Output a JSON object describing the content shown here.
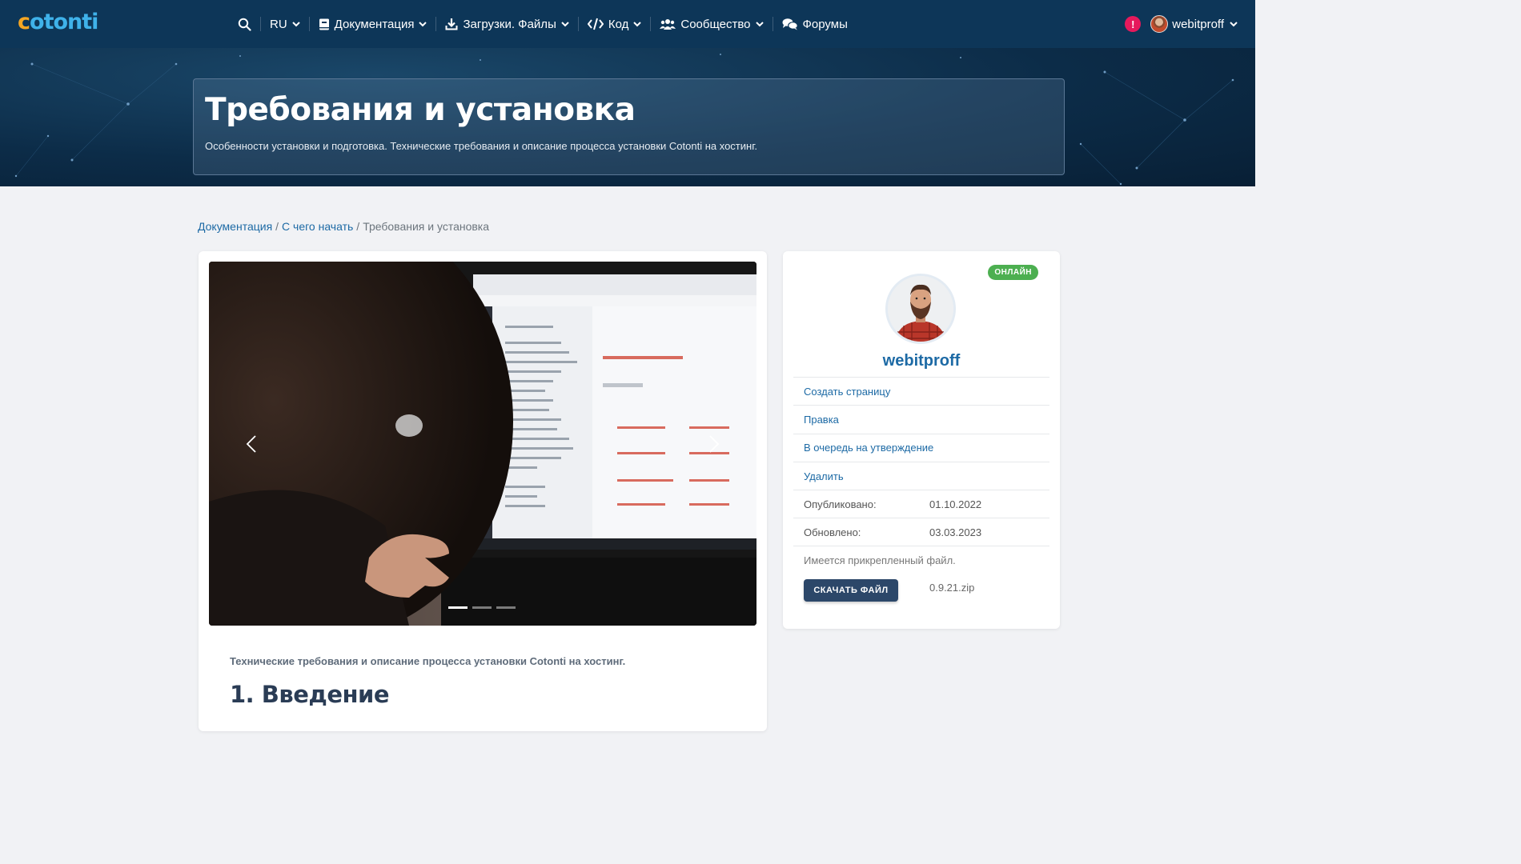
{
  "logo": {
    "first_letter": "c",
    "rest": "otonti"
  },
  "nav": {
    "search_icon": "search-icon",
    "lang": "RU",
    "docs": "Документация",
    "downloads": "Загрузки. Файлы",
    "code": "Код",
    "community": "Сообщество",
    "forums": "Форумы",
    "alert": "!",
    "user": "webitproff"
  },
  "hero": {
    "title": "Требования и установка",
    "subtitle": "Особенности установки и подготовка. Технические требования и описание процесса установки Cotonti на хостинг."
  },
  "breadcrumb": {
    "items": [
      "Документация",
      "С чего начать"
    ],
    "current": "Требования и установка",
    "separator": "/"
  },
  "article": {
    "lead": "Технические требования и описание процесса установки Cotonti на хостинг.",
    "heading": "1. Введение",
    "carousel_active": 1,
    "carousel_total": 3
  },
  "sidebar": {
    "status": "ОНЛАЙН",
    "username": "webitproff",
    "actions": [
      "Создать страницу",
      "Правка",
      "В очередь на утверждение",
      "Удалить"
    ],
    "published_label": "Опубликовано:",
    "published_value": "01.10.2022",
    "updated_label": "Обновлено:",
    "updated_value": "03.03.2023",
    "attachment_note": "Имеется прикрепленный файл.",
    "download_label": "СКАЧАТЬ ФАЙЛ",
    "file_name": "0.9.21.zip"
  },
  "colors": {
    "navbar": "#0d3658",
    "link": "#1d6aa5",
    "online": "#4caf50",
    "button": "#2c4769",
    "alert": "#e6195c"
  }
}
